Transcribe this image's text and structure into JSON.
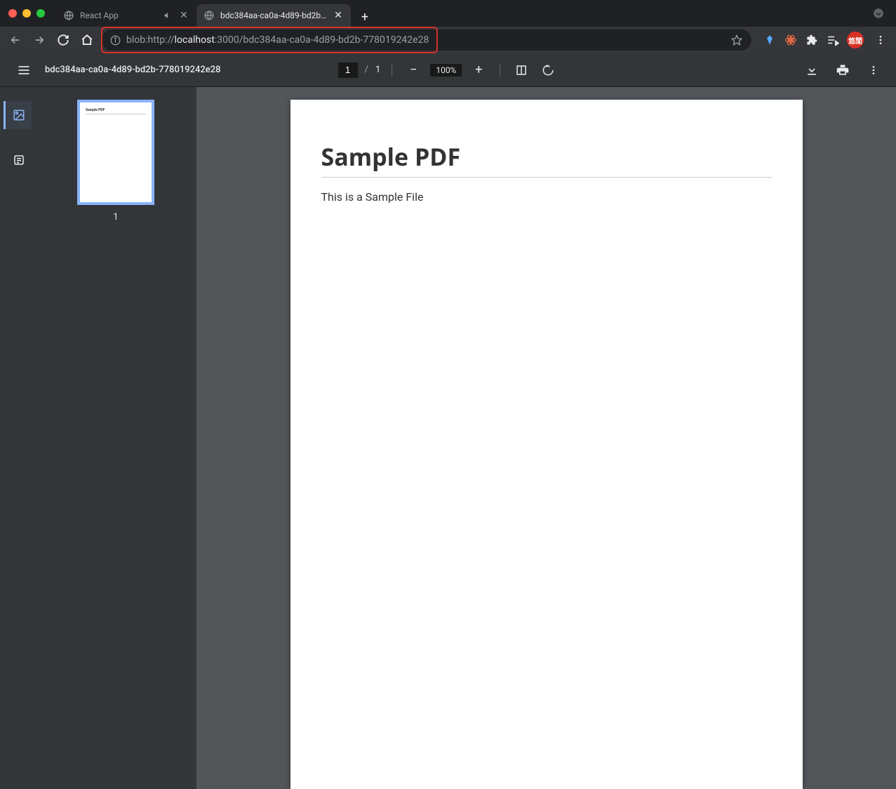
{
  "tabs": [
    {
      "title": "React App",
      "active": false
    },
    {
      "title": "bdc384aa-ca0a-4d89-bd2b-7",
      "active": true
    }
  ],
  "url": {
    "prefix": "blob:http://",
    "host": "localhost",
    "suffix": ":3000/bdc384aa-ca0a-4d89-bd2b-778019242e28"
  },
  "avatar_label": "悠閒",
  "pdf": {
    "filename": "bdc384aa-ca0a-4d89-bd2b-778019242e28",
    "current_page": "1",
    "total_pages": "1",
    "page_separator": "/",
    "zoom": "100%",
    "thumbnail_number": "1"
  },
  "document": {
    "heading": "Sample PDF",
    "body": "This is a Sample File"
  }
}
